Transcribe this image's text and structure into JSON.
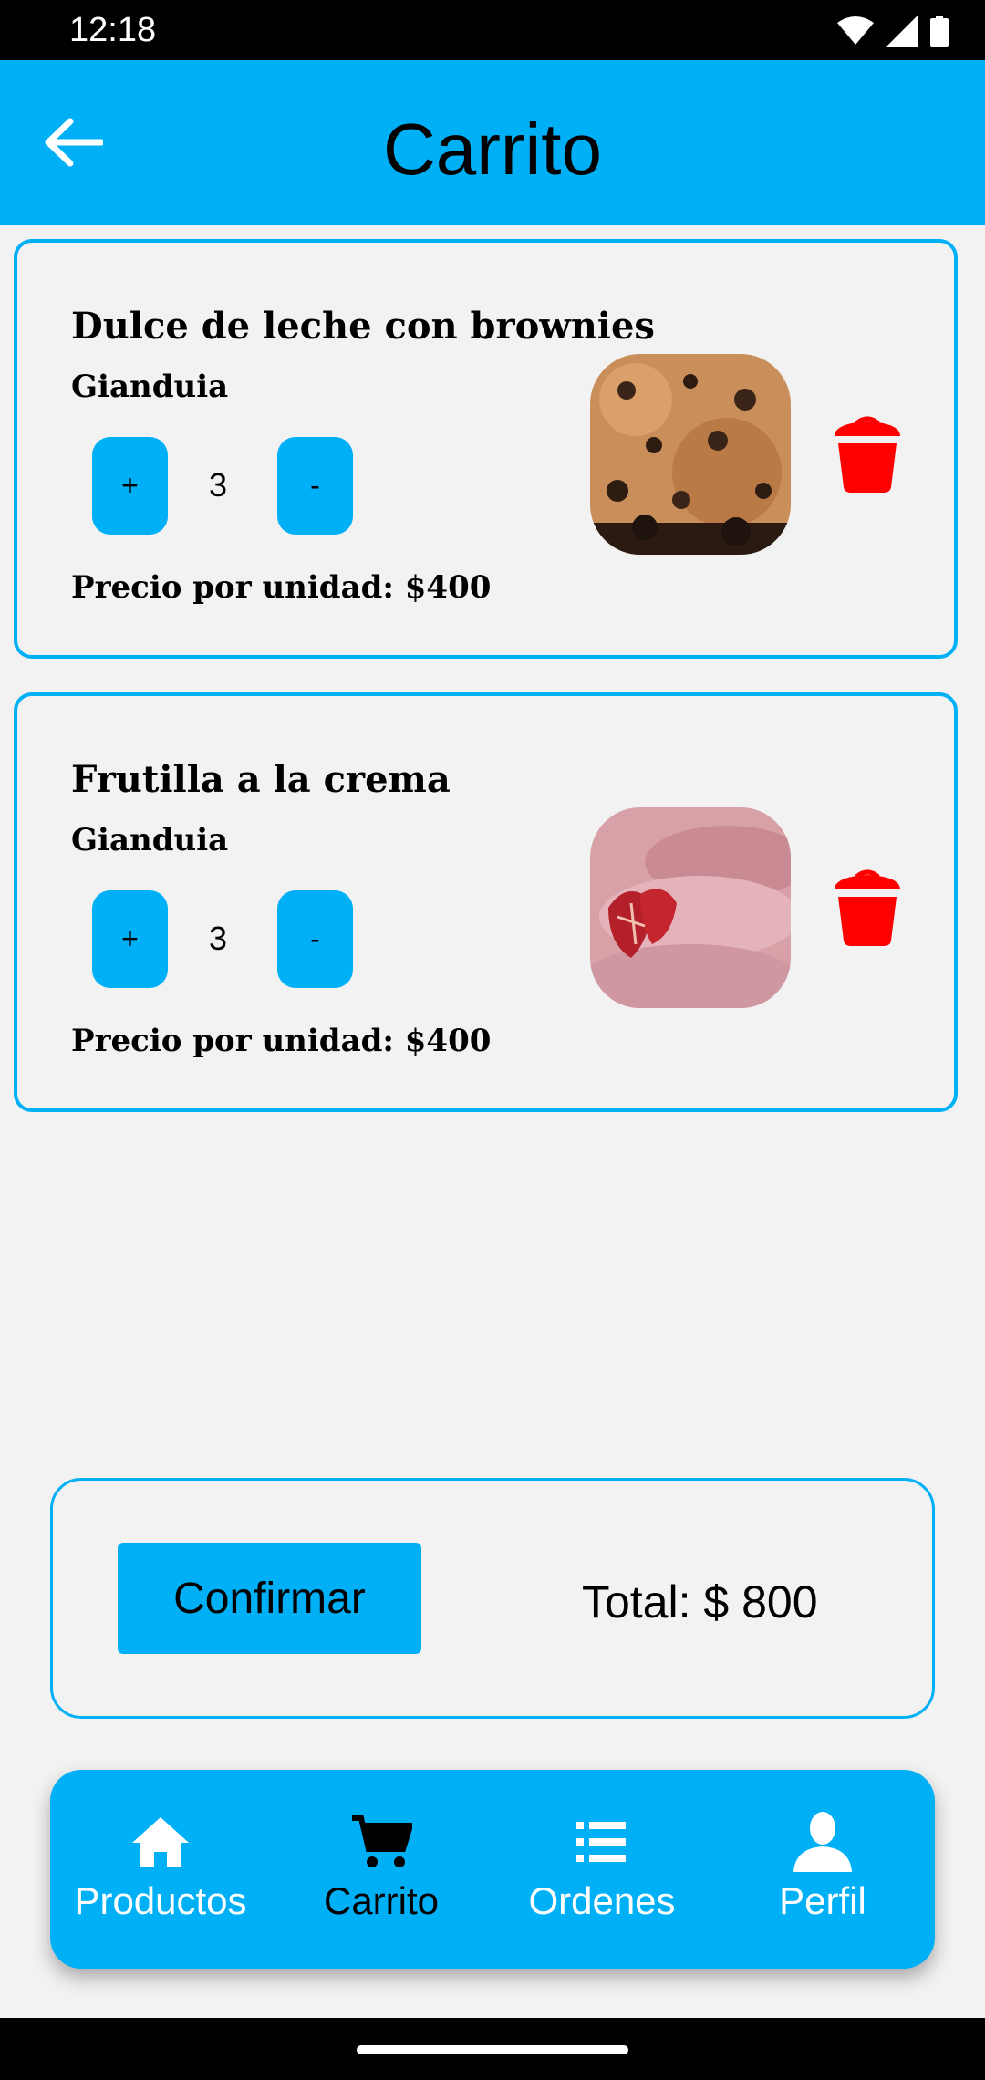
{
  "status_bar": {
    "time": "12:18"
  },
  "app_bar": {
    "title": "Carrito"
  },
  "cart_items": [
    {
      "name": "Dulce de leche con brownies",
      "brand": "Gianduia",
      "quantity": "3",
      "plus_label": "+",
      "minus_label": "-",
      "price": "Precio por unidad: $400"
    },
    {
      "name": "Frutilla a la crema",
      "brand": "Gianduia",
      "quantity": "3",
      "plus_label": "+",
      "minus_label": "-",
      "price": "Precio por unidad: $400"
    }
  ],
  "summary": {
    "confirm_label": "Confirmar",
    "total": "Total: $ 800"
  },
  "bottom_nav": [
    {
      "label": "Productos",
      "icon": "home-icon",
      "active": false
    },
    {
      "label": "Carrito",
      "icon": "cart-icon",
      "active": true
    },
    {
      "label": "Ordenes",
      "icon": "list-icon",
      "active": false
    },
    {
      "label": "Perfil",
      "icon": "person-icon",
      "active": false
    }
  ],
  "colors": {
    "accent": "#00b0f7",
    "delete": "#ff0000",
    "background": "#f2f2f2"
  }
}
